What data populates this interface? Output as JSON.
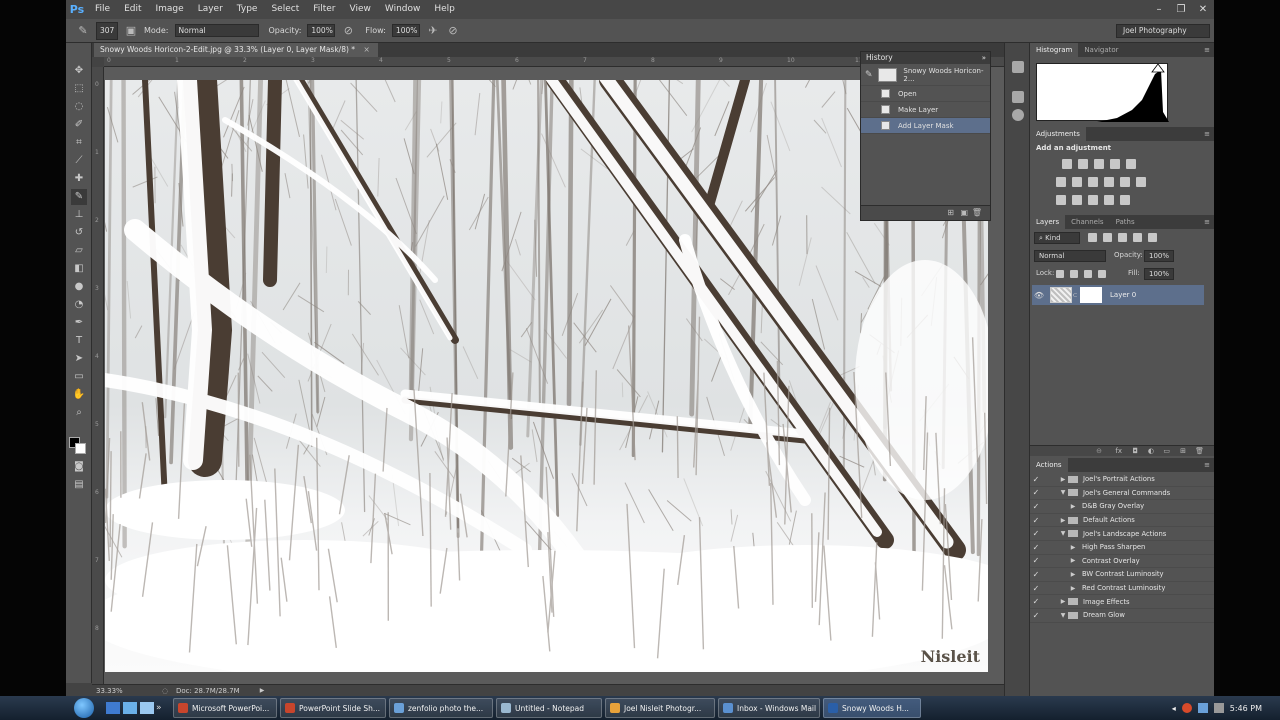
{
  "app": {
    "logo": "Ps",
    "menu": [
      "File",
      "Edit",
      "Image",
      "Layer",
      "Type",
      "Select",
      "Filter",
      "View",
      "Window",
      "Help"
    ],
    "window_controls": [
      "–",
      "❐",
      "✕"
    ]
  },
  "options_bar": {
    "brush_size": "307",
    "mode_label": "Mode:",
    "mode_value": "Normal",
    "opacity_label": "Opacity:",
    "opacity_value": "100%",
    "flow_label": "Flow:",
    "flow_value": "100%",
    "workspace": "Joel Photography"
  },
  "document": {
    "tab_title": "Snowy Woods Horicon-2-Edit.jpg @ 33.3% (Layer 0, Layer Mask/8) *",
    "ruler_ticks": [
      "0",
      "1",
      "2",
      "3",
      "4",
      "5",
      "6",
      "7",
      "8",
      "9",
      "10",
      "11"
    ],
    "watermark": "Nisleit",
    "zoom": "33.33%",
    "doc_info": "Doc: 28.7M/28.7M"
  },
  "history": {
    "title": "History",
    "snapshot": "Snowy Woods Horicon-2...",
    "steps": [
      "Open",
      "Make Layer",
      "Add Layer Mask"
    ],
    "selected_index": 2
  },
  "histogram_panel": {
    "tabs": [
      "Histogram",
      "Navigator"
    ]
  },
  "adjustments": {
    "title": "Adjustments",
    "prompt": "Add an adjustment"
  },
  "layers": {
    "tabs": [
      "Layers",
      "Channels",
      "Paths"
    ],
    "filter": "Kind",
    "blend_mode": "Normal",
    "opacity_label": "Opacity:",
    "opacity_value": "100%",
    "lock_label": "Lock:",
    "fill_label": "Fill:",
    "fill_value": "100%",
    "items": [
      {
        "name": "Layer 0",
        "visible": true
      }
    ]
  },
  "actions": {
    "title": "Actions",
    "items": [
      {
        "label": "Joel's Portrait Actions",
        "type": "set",
        "expanded": false,
        "indent": 0
      },
      {
        "label": "Joel's General Commands",
        "type": "set",
        "expanded": true,
        "indent": 0
      },
      {
        "label": "D&B Gray Overlay",
        "type": "action",
        "expanded": false,
        "indent": 1
      },
      {
        "label": "Default Actions",
        "type": "set",
        "expanded": false,
        "indent": 0
      },
      {
        "label": "Joel's Landscape Actions",
        "type": "set",
        "expanded": true,
        "indent": 0
      },
      {
        "label": "High Pass Sharpen",
        "type": "action",
        "expanded": false,
        "indent": 1
      },
      {
        "label": "Contrast Overlay",
        "type": "action",
        "expanded": false,
        "indent": 1
      },
      {
        "label": "BW Contrast Luminosity",
        "type": "action",
        "expanded": false,
        "indent": 1
      },
      {
        "label": "Red Contrast Luminosity",
        "type": "action",
        "expanded": false,
        "indent": 1
      },
      {
        "label": "Image Effects",
        "type": "set",
        "expanded": false,
        "indent": 0
      },
      {
        "label": "Dream Glow",
        "type": "set",
        "expanded": true,
        "indent": 0
      }
    ]
  },
  "taskbar": {
    "tasks": [
      {
        "label": "Microsoft PowerPoi...",
        "color": "#c8452c"
      },
      {
        "label": "PowerPoint Slide Sh...",
        "color": "#c8452c"
      },
      {
        "label": "zenfolio photo the...",
        "color": "#6aa0d8"
      },
      {
        "label": "Untitled - Notepad",
        "color": "#9ab8d0"
      },
      {
        "label": "Joel Nisleit Photogr...",
        "color": "#e8a23a"
      },
      {
        "label": "Inbox - Windows Mail",
        "color": "#5a90d0"
      },
      {
        "label": "Snowy Woods H...",
        "color": "#2a5fa8"
      }
    ],
    "active_index": 6,
    "clock": "5:46 PM"
  }
}
